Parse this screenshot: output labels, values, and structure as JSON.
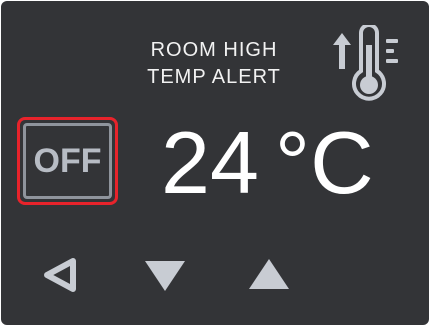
{
  "alert": {
    "line1": "ROOM HIGH",
    "line2": "TEMP ALERT"
  },
  "icons": {
    "status": "temperature-rising-icon",
    "back": "triangle-left-outline-icon",
    "down": "triangle-down-icon",
    "up": "triangle-up-icon"
  },
  "power_button": {
    "label": "OFF",
    "selected": true
  },
  "temperature": {
    "value": "24",
    "unit": "°C"
  },
  "colors": {
    "background": "#333437",
    "selection": "#e8232b",
    "button_border": "#8f949c",
    "button_text": "#b7bcc4",
    "icon": "#c8ccd3",
    "text": "#ffffff"
  }
}
